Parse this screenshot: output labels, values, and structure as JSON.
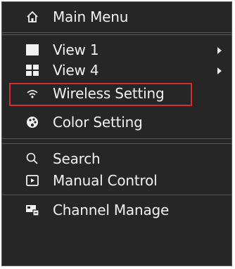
{
  "menu": {
    "title": "Main Menu",
    "items": [
      {
        "label": "View 1",
        "icon": "single-view-icon"
      },
      {
        "label": "View 4",
        "icon": "quad-view-icon"
      },
      {
        "label": "Wireless Setting",
        "icon": "wifi-icon"
      },
      {
        "label": "Color Setting",
        "icon": "palette-icon"
      },
      {
        "label": "Search",
        "icon": "search-icon"
      },
      {
        "label": "Manual Control",
        "icon": "manual-control-icon"
      },
      {
        "label": "Channel Manage",
        "icon": "channel-manage-icon"
      }
    ]
  },
  "colors": {
    "background": "#262626",
    "text": "#f2f2f2",
    "highlight_border": "#d62d2d",
    "divider": "#5a5a5a"
  }
}
